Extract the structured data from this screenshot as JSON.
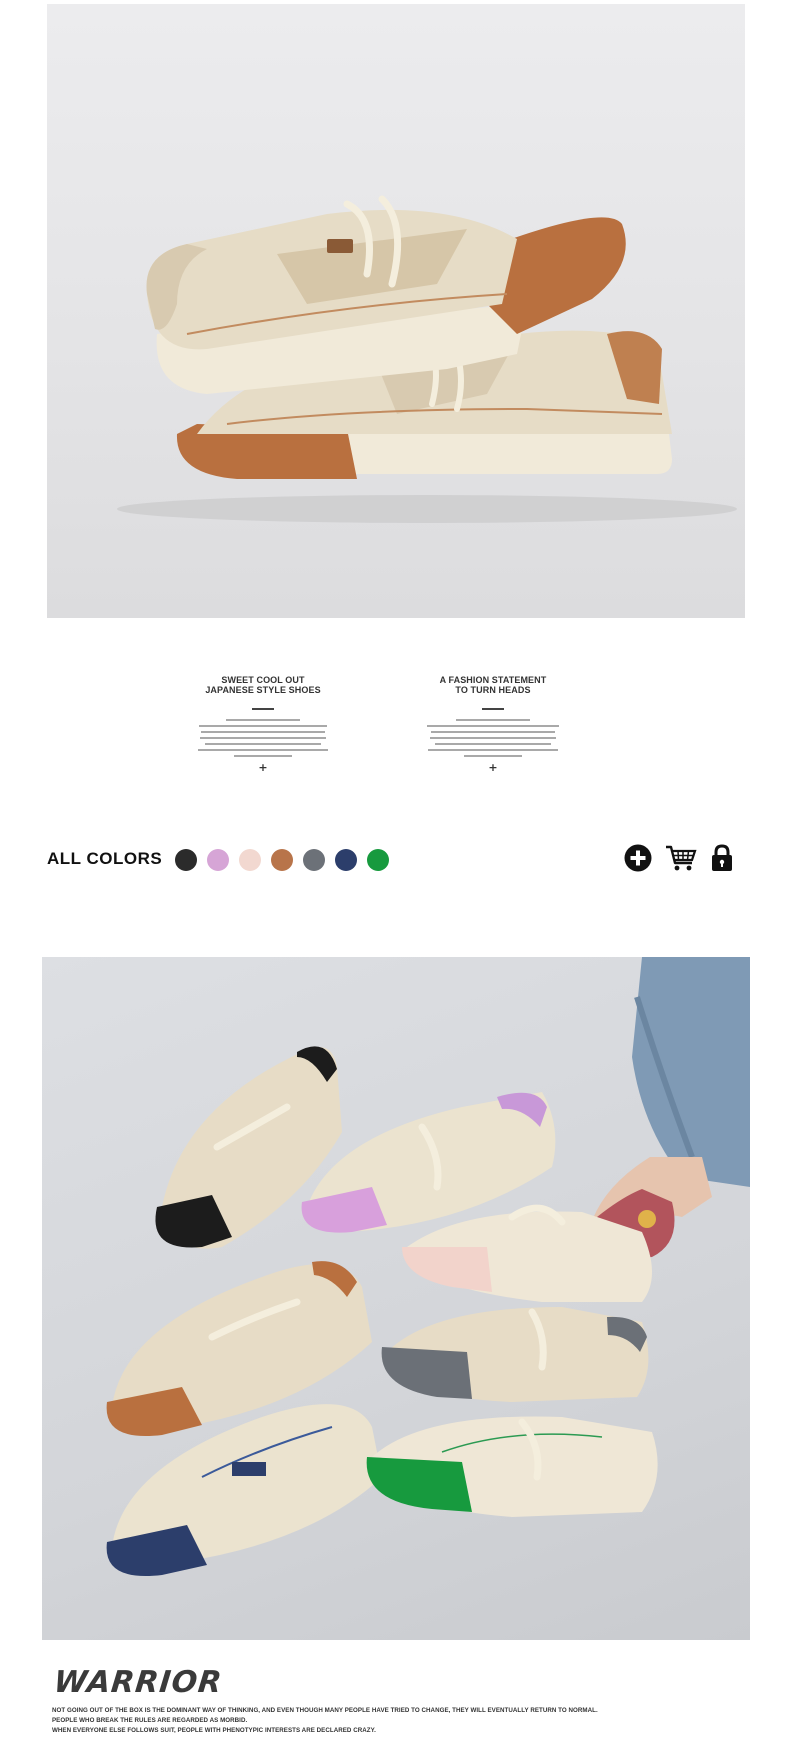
{
  "features": [
    {
      "title_line1": "SWEET COOL OUT",
      "title_line2": "JAPANESE STYLE SHOES",
      "plus": "+"
    },
    {
      "title_line1": "A FASHION STATEMENT",
      "title_line2": "TO TURN HEADS",
      "plus": "+"
    }
  ],
  "colors_section": {
    "label": "ALL COLORS",
    "swatches": [
      {
        "name": "black",
        "hex": "#2b2b2b"
      },
      {
        "name": "lilac",
        "hex": "#d6a5d6"
      },
      {
        "name": "pink",
        "hex": "#f2d8d0"
      },
      {
        "name": "caramel",
        "hex": "#b8744a"
      },
      {
        "name": "grey",
        "hex": "#6c7178"
      },
      {
        "name": "navy",
        "hex": "#2c3e6b"
      },
      {
        "name": "green",
        "hex": "#179a3e"
      }
    ],
    "actions": [
      {
        "name": "add-icon"
      },
      {
        "name": "cart-icon"
      },
      {
        "name": "lock-icon"
      }
    ]
  },
  "brand": {
    "title": "WARRIOR",
    "lines": [
      "NOT GOING OUT OF THE BOX IS THE DOMINANT WAY OF THINKING, AND EVEN THOUGH MANY PEOPLE HAVE TRIED TO CHANGE, THEY WILL EVENTUALLY RETURN TO NORMAL.",
      "PEOPLE WHO BREAK THE RULES ARE REGARDED AS MORBID.",
      "WHEN EVERYONE ELSE FOLLOWS SUIT, PEOPLE WITH PHENOTYPIC INTERESTS ARE DECLARED CRAZY."
    ]
  },
  "palette": {
    "canvas": "#ffffff",
    "text": "#222222",
    "shoe_body": "#e8dfcc",
    "shoe_sole": "#f1ead9",
    "toe_caramel": "#b9703f"
  }
}
